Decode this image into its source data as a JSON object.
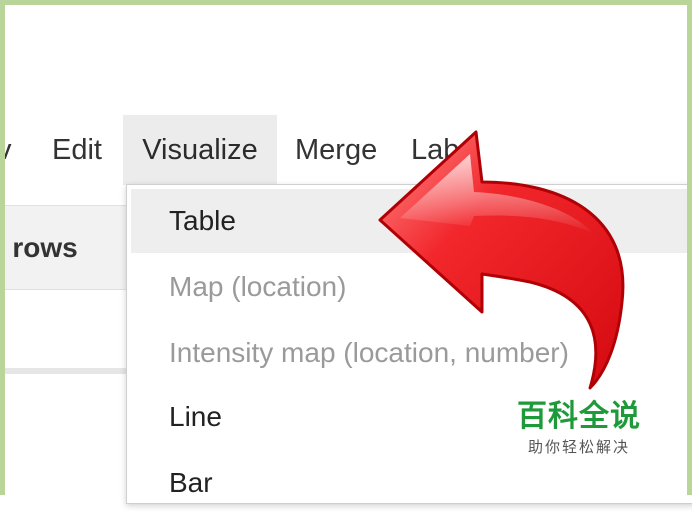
{
  "menubar": {
    "items": [
      {
        "label": "v"
      },
      {
        "label": "Edit"
      },
      {
        "label": "Visualize"
      },
      {
        "label": "Merge"
      },
      {
        "label": "Lab"
      }
    ]
  },
  "toolbar": {
    "rows_label": "ll rows"
  },
  "dropdown": {
    "items": [
      {
        "label": "Table",
        "state": "highlighted"
      },
      {
        "label": "Map (location)",
        "state": "disabled"
      },
      {
        "label": "Intensity map (location, number)",
        "state": "disabled"
      },
      {
        "label": "Line",
        "state": "enabled"
      },
      {
        "label": "Bar",
        "state": "enabled"
      }
    ]
  },
  "annotation": {
    "icon": "curved-arrow-icon",
    "color": "#e8141a"
  },
  "watermark": {
    "title": "百科全说",
    "subtitle": "助你轻松解决"
  },
  "colors": {
    "frame": "#b9d59a",
    "menu_active_bg": "#ececec",
    "watermark_green": "#1f9a3a"
  }
}
